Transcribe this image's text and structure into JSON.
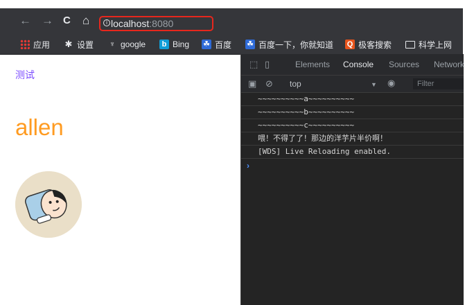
{
  "browser": {
    "url_host": "localhost",
    "url_port": ":8080",
    "nav": {
      "back": "←",
      "forward": "→",
      "reload": "C",
      "home": "⌂"
    }
  },
  "bookmarks": [
    {
      "label": "应用",
      "icon": "apps-grid-icon"
    },
    {
      "label": "设置",
      "icon": "gear-icon"
    },
    {
      "label": "google",
      "icon": "trophy-icon"
    },
    {
      "label": "Bing",
      "icon": "bing-icon"
    },
    {
      "label": "百度",
      "icon": "baidu-paw-icon"
    },
    {
      "label": "百度一下，你就知道",
      "icon": "baidu-paw-icon"
    },
    {
      "label": "极客搜索",
      "icon": "geek-search-icon"
    },
    {
      "label": "科学上网",
      "icon": "folder-icon"
    }
  ],
  "page": {
    "link_text": "测试",
    "title": "allen",
    "avatar": "avatar-illustration",
    "colors": {
      "link": "#7c4dff",
      "title": "#ff9b21"
    }
  },
  "devtools": {
    "tabs": [
      "Elements",
      "Console",
      "Sources",
      "Network"
    ],
    "active_tab": "Console",
    "context": "top",
    "filter_placeholder": "Filter",
    "logs": [
      "~~~~~~~~~~a~~~~~~~~~~",
      "~~~~~~~~~~b~~~~~~~~~~",
      "~~~~~~~~~~c~~~~~~~~~~",
      "喂！不得了了！那边的洋芋片半价啊！",
      "[WDS] Live Reloading enabled."
    ],
    "prompt": "›"
  }
}
